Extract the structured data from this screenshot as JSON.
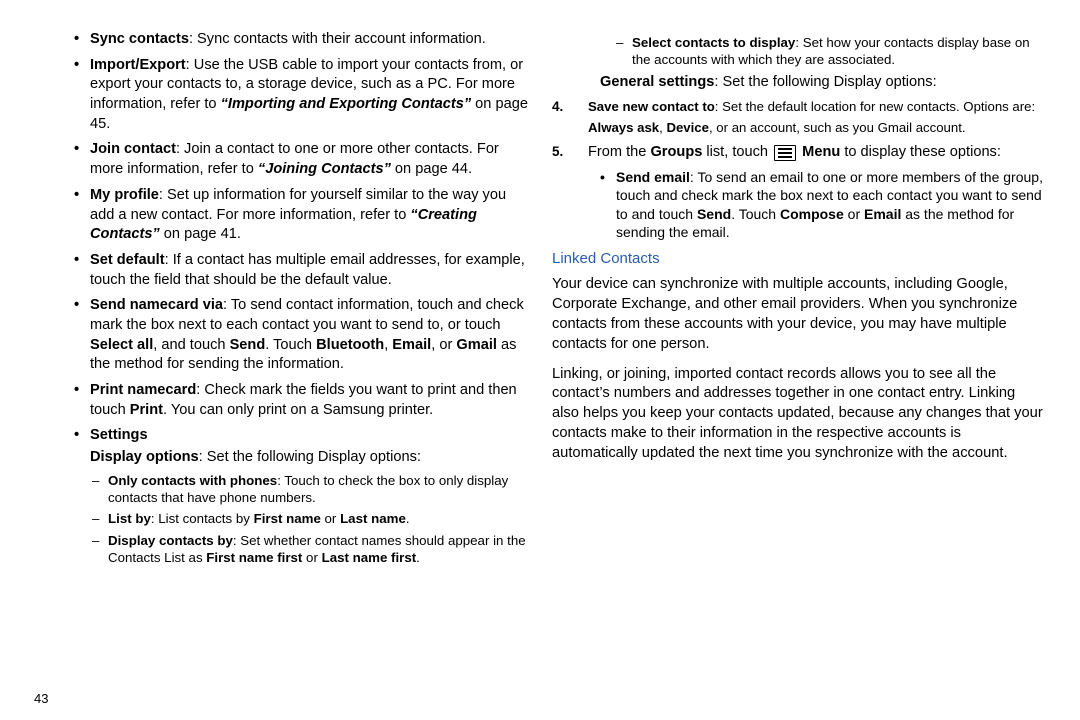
{
  "left": {
    "sync": {
      "b": "Sync contacts",
      "t": ": Sync contacts with their account information."
    },
    "import": {
      "b": "Import/Export",
      "t": ": Use the USB cable to import your contacts from, or export your contacts to, a storage device, such as a PC. For more information, refer to ",
      "ref": "“Importing and Exporting Contacts”",
      "tail": "  on page 45."
    },
    "join": {
      "b": "Join contact",
      "t": ": Join a contact to one or more other contacts. For more information, refer to ",
      "ref": "“Joining Contacts”",
      "tail": "  on page 44."
    },
    "profile": {
      "b": "My profile",
      "t": ": Set up information for yourself similar to the way you add a new contact. For more information, refer to ",
      "ref": "“Creating Contacts”",
      "tail": "  on page 41."
    },
    "setdef": {
      "b": "Set default",
      "t": ": If a contact has multiple email addresses, for example, touch the field that should be the default value."
    },
    "sendvia": {
      "b": "Send namecard via",
      "pre": ": To send contact information, touch and check mark the box next to each contact you want to send to, or touch ",
      "b2": "Select all",
      "mid": ", and touch ",
      "b3": "Send",
      "mid2": ". Touch ",
      "b4": "Bluetooth",
      "c1": ", ",
      "b5": "Email",
      "c2": ", or ",
      "b6": "Gmail",
      "post": " as the method for sending the information."
    },
    "printnc": {
      "b": "Print namecard",
      "t": ": Check mark the fields you want to print and then touch ",
      "b2": "Print",
      "tail": ". You can only print on a Samsung printer."
    },
    "settings_b": "Settings",
    "dispopt_b": "Display options",
    "dispopt_t": ": Set the following Display options:",
    "d1": {
      "b": "Only contacts with phones",
      "t": ": Touch to check the box to only display contacts that have phone numbers."
    },
    "d2": {
      "b": "List by",
      "t": ": List contacts by ",
      "b2": "First name",
      "or": " or ",
      "b3": "Last name",
      "dot": "."
    },
    "d3": {
      "b": "Display contacts by",
      "t": ": Set whether contact names should appear in the Contacts List as ",
      "b2": "First name first",
      "or": " or ",
      "b3": "Last name first",
      "dot": "."
    }
  },
  "right": {
    "seldisp": {
      "b": "Select contacts to display",
      "t": ": Set how your contacts display base on the accounts with which they are associated."
    },
    "gensett_b": "General settings",
    "gensett_t": ": Set the following Display options:",
    "step4": {
      "n": "4.",
      "b": "Save new contact to",
      "t": ": Set the default location for new contacts. Options are:",
      "b2": "Always ask",
      "c": ", ",
      "b3": "Device",
      "tail": ", or an account, such as you Gmail account."
    },
    "step5": {
      "n": "5.",
      "pre": "From the ",
      "b": "Groups",
      "mid": " list, touch ",
      "b2": "Menu",
      "post": " to display these options:"
    },
    "sendmail": {
      "b": "Send email",
      "t": ": To send an email to one or more members of the group, touch and check mark the box next to each contact you want to send to and touch ",
      "b2": "Send",
      "mid": ". Touch ",
      "b3": "Compose",
      "or": " or ",
      "b4": "Email",
      "post": " as the method for sending the email."
    },
    "heading": "Linked Contacts",
    "p1": "Your device can synchronize with multiple accounts, including Google, Corporate Exchange, and other email providers. When you synchronize contacts from these accounts with your device, you may have multiple contacts for one person.",
    "p2": "Linking, or joining, imported contact records allows you to see all the contact’s numbers and addresses together in one contact entry. Linking also helps you keep your contacts updated, because any changes that your contacts make to their information in the respective accounts is automatically updated the next time you synchronize with the account."
  },
  "footer": "43"
}
